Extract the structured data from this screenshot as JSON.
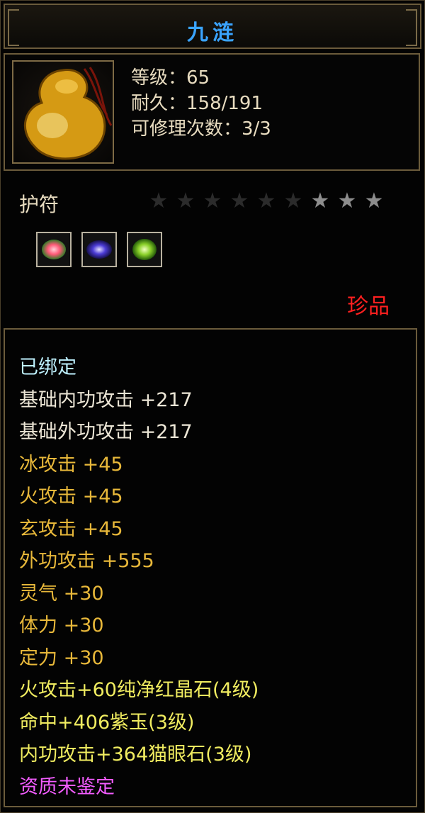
{
  "title": "九涟",
  "item": {
    "level": "等级：65",
    "durability": "耐久：158/191",
    "repairs": "可修理次数：3/3"
  },
  "category": "护符",
  "stars": {
    "total": 9,
    "filled": 6,
    "dim_color": "#2b2b2b",
    "bright_color": "#8d8d8d"
  },
  "gems": [
    "red-gem-icon",
    "purple-gem-icon",
    "green-gem-icon"
  ],
  "rarity": "珍品",
  "attributes": [
    {
      "text": "已绑定",
      "color": "cyan"
    },
    {
      "text": "基础内功攻击 +217",
      "color": "white"
    },
    {
      "text": "基础外功攻击 +217",
      "color": "white"
    },
    {
      "text": "冰攻击 +45",
      "color": "gold"
    },
    {
      "text": "火攻击 +45",
      "color": "gold"
    },
    {
      "text": "玄攻击 +45",
      "color": "gold"
    },
    {
      "text": "外功攻击 +555",
      "color": "gold"
    },
    {
      "text": "灵气 +30",
      "color": "gold"
    },
    {
      "text": "体力 +30",
      "color": "gold"
    },
    {
      "text": "定力 +30",
      "color": "gold"
    },
    {
      "text": "火攻击+60纯净红晶石(4级)",
      "color": "yellow"
    },
    {
      "text": "命中+406紫玉(3级)",
      "color": "yellow"
    },
    {
      "text": "内功攻击+364猫眼石(3级)",
      "color": "yellow"
    },
    {
      "text": "资质未鉴定",
      "color": "pink"
    }
  ],
  "colors": {
    "title": "#3aa4ff",
    "rarity": "#ff2020",
    "border": "#6b5b3b"
  }
}
